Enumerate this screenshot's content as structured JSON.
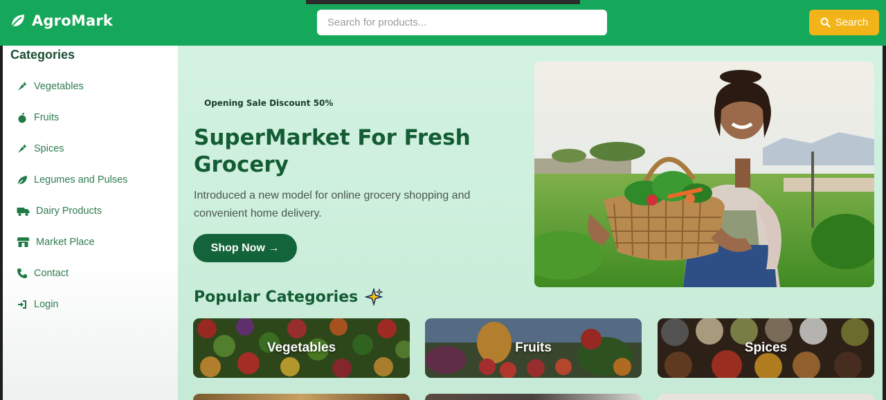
{
  "brand": {
    "name": "AgroMark",
    "logo_icon": "leaf-icon"
  },
  "search": {
    "placeholder": "Search for products...",
    "value": "",
    "button_label": "Search",
    "button_icon": "search-icon"
  },
  "sidebar": {
    "title": "Categories",
    "items": [
      {
        "label": "Vegetables",
        "icon": "carrot-icon"
      },
      {
        "label": "Fruits",
        "icon": "apple-icon"
      },
      {
        "label": "Spices",
        "icon": "pepper-icon"
      },
      {
        "label": "Legumes and Pulses",
        "icon": "seedling-icon"
      },
      {
        "label": "Dairy Products",
        "icon": "truck-icon"
      },
      {
        "label": "Market Place",
        "icon": "store-icon"
      },
      {
        "label": "Contact",
        "icon": "phone-icon"
      },
      {
        "label": "Login",
        "icon": "sign-in-icon"
      }
    ]
  },
  "hero": {
    "promo": "Opening Sale Discount 50%",
    "title": "SuperMarket For Fresh Grocery",
    "description": "Introduced a new model for online grocery shopping and convenient home delivery.",
    "button_label": "Shop Now →"
  },
  "popular": {
    "title": "Popular Categories",
    "icon": "sparkle-icon",
    "cards": [
      {
        "label": "Vegetables"
      },
      {
        "label": "Fruits"
      },
      {
        "label": "Spices"
      }
    ]
  },
  "colors": {
    "header": "#16a85a",
    "search_button": "#f2b418",
    "primary_dark": "#13643a",
    "main_bg": "#d4f2e2"
  }
}
